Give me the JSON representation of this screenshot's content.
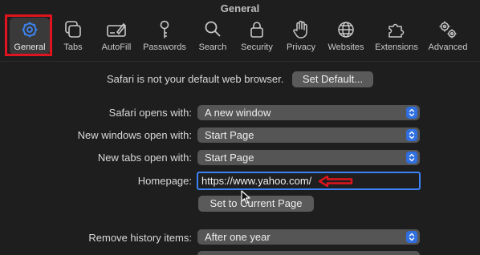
{
  "window": {
    "title": "General"
  },
  "toolbar": {
    "items": [
      {
        "label": "General",
        "icon": "gear-icon",
        "active": true
      },
      {
        "label": "Tabs",
        "icon": "tabs-icon"
      },
      {
        "label": "AutoFill",
        "icon": "autofill-icon"
      },
      {
        "label": "Passwords",
        "icon": "key-icon"
      },
      {
        "label": "Search",
        "icon": "magnifier-icon"
      },
      {
        "label": "Security",
        "icon": "lock-icon"
      },
      {
        "label": "Privacy",
        "icon": "hand-icon"
      },
      {
        "label": "Websites",
        "icon": "globe-icon"
      },
      {
        "label": "Extensions",
        "icon": "puzzle-icon"
      },
      {
        "label": "Advanced",
        "icon": "gears-icon"
      }
    ]
  },
  "default_browser": {
    "message": "Safari is not your default web browser.",
    "button_label": "Set Default..."
  },
  "settings": {
    "safari_opens_with": {
      "label": "Safari opens with:",
      "value": "A new window"
    },
    "new_windows_open_with": {
      "label": "New windows open with:",
      "value": "Start Page"
    },
    "new_tabs_open_with": {
      "label": "New tabs open with:",
      "value": "Start Page"
    },
    "homepage": {
      "label": "Homepage:",
      "value": "https://www.yahoo.com/"
    },
    "set_current_page_label": "Set to Current Page",
    "remove_history_items": {
      "label": "Remove history items:",
      "value": "After one year"
    }
  },
  "colors": {
    "accent": "#2f6fe0",
    "annotation": "#e0141e",
    "background": "#1e1e1e"
  }
}
